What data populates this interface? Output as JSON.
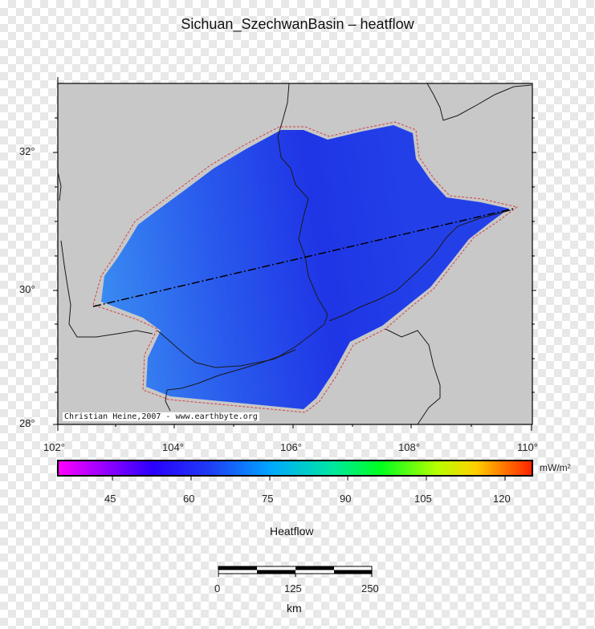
{
  "title": "Sichuan_SzechwanBasin – heatflow",
  "map": {
    "lat_labels": [
      "32°",
      "30°",
      "28°"
    ],
    "lon_labels": [
      "102°",
      "104°",
      "106°",
      "108°",
      "110°"
    ],
    "credit": "Christian Heine,2007 - www.earthbyte.org",
    "colors": {
      "land": "#c8c8c8",
      "basin_low": "#1c2ee8",
      "basin_mid": "#2f63ee",
      "basin_high": "#3a8af0",
      "outline": "#d44040"
    }
  },
  "colorbar": {
    "ticks": [
      "45",
      "60",
      "75",
      "90",
      "105",
      "120"
    ],
    "unit": "mW/m²",
    "label": "Heatflow"
  },
  "scalebar": {
    "ticks": [
      "0",
      "125",
      "250"
    ],
    "unit": "km"
  }
}
